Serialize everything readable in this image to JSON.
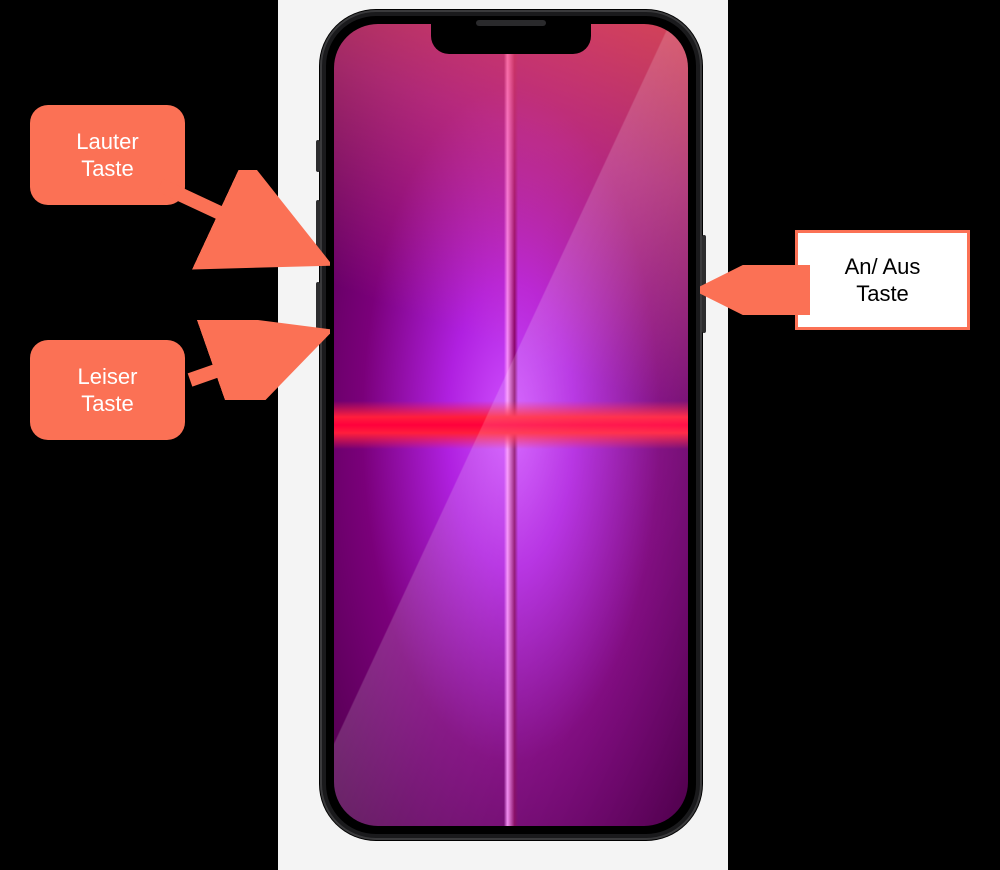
{
  "callouts": {
    "volume_up": "Lauter\nTaste",
    "volume_down": "Leiser\nTaste",
    "power": "An/ Aus\nTaste"
  },
  "colors": {
    "callout_red": "#fb7155",
    "callout_white_bg": "#ffffff",
    "callout_white_border": "#fb7155",
    "panel_bg": "#f4f4f4",
    "stage_bg": "#000000"
  }
}
